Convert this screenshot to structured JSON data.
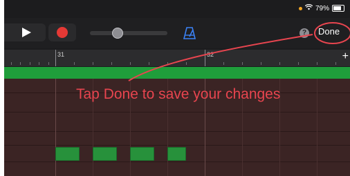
{
  "status_bar": {
    "battery": "79%",
    "icons": [
      "location-dot-icon",
      "wifi-icon",
      "battery-icon"
    ]
  },
  "toolbar": {
    "icons": [
      "play-icon",
      "record-icon",
      "metronome-icon"
    ],
    "help_label": "?",
    "done_label": "Done"
  },
  "ruler": {
    "bars": [
      "31",
      "32"
    ],
    "add_label": "+"
  },
  "annotation": {
    "text": "Tap Done to save your changes",
    "color": "#e8454f"
  },
  "colors": {
    "region": "#1f9e3b",
    "note": "#27913b",
    "record": "#e53935",
    "accent": "#e8454f"
  }
}
